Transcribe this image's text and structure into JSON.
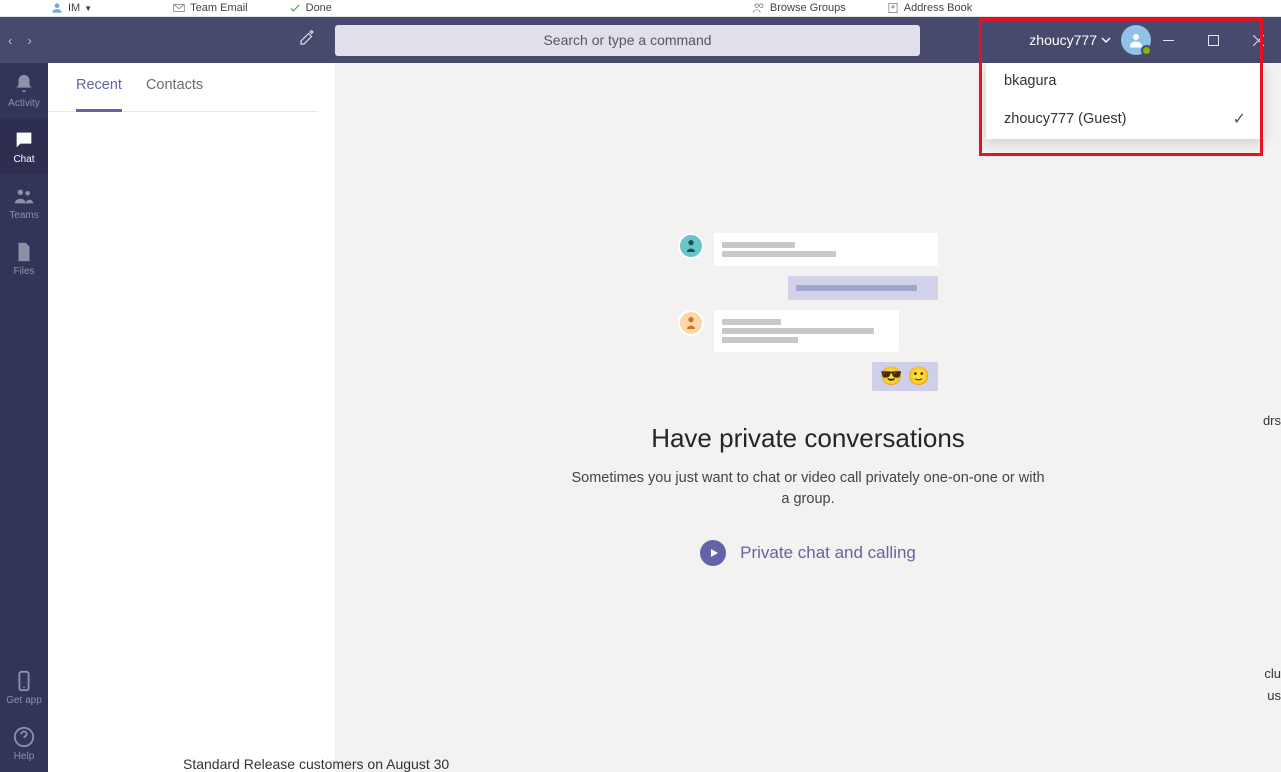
{
  "outlook_ribbon": {
    "im_label": "IM",
    "team_email_label": "Team Email",
    "done_label": "Done",
    "browse_groups_label": "Browse Groups",
    "address_book_label": "Address Book"
  },
  "title_bar": {
    "search_placeholder": "Search or type a command",
    "account_name": "zhoucy777"
  },
  "rail": {
    "activity": "Activity",
    "chat": "Chat",
    "teams": "Teams",
    "files": "Files",
    "get_app": "Get app",
    "help": "Help"
  },
  "tabs": {
    "recent": "Recent",
    "contacts": "Contacts"
  },
  "empty_state": {
    "headline": "Have private conversations",
    "subtext": "Sometimes you just want to chat or video call privately one-on-one or with a group.",
    "link_label": "Private chat and calling",
    "emojis": "😎 🙂"
  },
  "dropdown": {
    "option1": "bkagura",
    "option2": "zhoucy777 (Guest)"
  },
  "fragments": {
    "bottom": "Standard Release customers on August 30",
    "right1": "drs",
    "right2": "clu",
    "right3": "us"
  }
}
